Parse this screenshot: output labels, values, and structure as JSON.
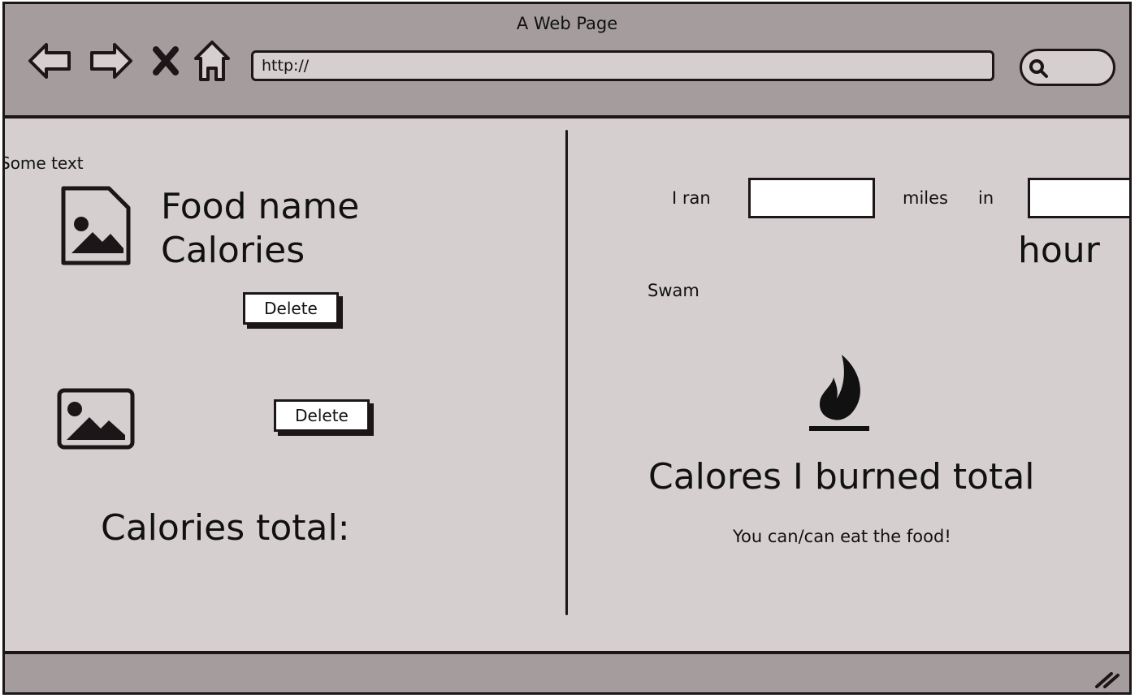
{
  "window": {
    "title": "A Web Page"
  },
  "toolbar": {
    "back_icon": "back-arrow-icon",
    "forward_icon": "forward-arrow-icon",
    "stop_icon": "close-x-icon",
    "home_icon": "home-icon",
    "url_value": "http://",
    "search_icon": "search-icon"
  },
  "left_panel": {
    "some_text": "Some text",
    "food_item_1": {
      "image_icon": "image-icon",
      "name": "Food name",
      "calories": "Calories",
      "delete_label": "Delete"
    },
    "food_item_2": {
      "image_icon": "image-icon",
      "delete_label": "Delete"
    },
    "calories_total_label": "Calories total:"
  },
  "right_panel": {
    "ran_prefix": "I ran",
    "miles_label": "miles",
    "in_label": "in",
    "hour_label": "hour",
    "swam_label": "Swam",
    "flame_icon": "flame-icon",
    "burned_total_label": "Calores I burned total",
    "result_message": "You can/can eat the food!"
  }
}
